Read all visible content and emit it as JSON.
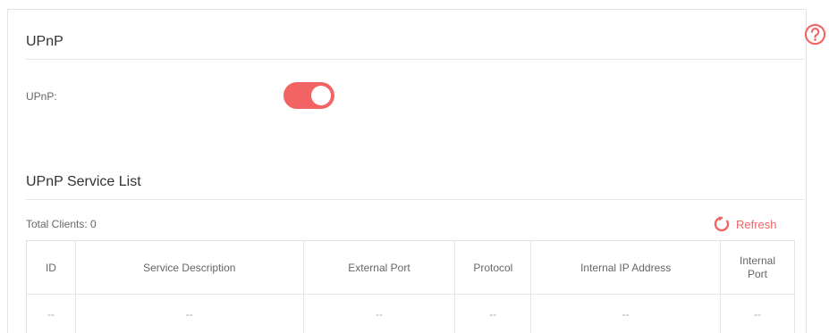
{
  "upnp_section": {
    "title": "UPnP",
    "field_label": "UPnP:",
    "enabled": true
  },
  "service_list": {
    "title": "UPnP Service List",
    "total_label": "Total Clients: 0",
    "refresh_label": "Refresh",
    "columns": [
      "ID",
      "Service Description",
      "External Port",
      "Protocol",
      "Internal IP Address",
      "Internal\nPort"
    ],
    "rows": [
      [
        "--",
        "--",
        "--",
        "--",
        "--",
        "--"
      ]
    ]
  },
  "colors": {
    "accent": "#f26463",
    "border": "#e3e3e3"
  },
  "icons": {
    "help": "question-circle-icon",
    "refresh": "refresh-icon"
  }
}
